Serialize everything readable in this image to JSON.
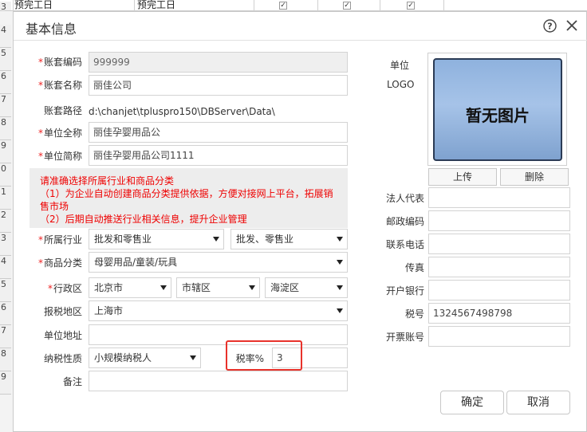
{
  "background": {
    "row_numbers": [
      "3",
      "4",
      "5",
      "6",
      "7",
      "8",
      "9",
      "0",
      "1",
      "2",
      "3",
      "4",
      "5",
      "6",
      "7",
      "8",
      "9"
    ],
    "cell1": "预完工日",
    "cell2": "预完工日"
  },
  "dialog": {
    "title": "基本信息",
    "form": {
      "account_code": {
        "label": "账套编码",
        "value": "999999"
      },
      "account_name": {
        "label": "账套名称",
        "value": "丽佳公司"
      },
      "account_path": {
        "label": "账套路径",
        "value": "d:\\chanjet\\tpluspro150\\DBServer\\Data\\"
      },
      "unit_fullname": {
        "label": "单位全称",
        "value": "丽佳孕婴用品公"
      },
      "unit_shortname": {
        "label": "单位简称",
        "value": "丽佳孕婴用品公司1111"
      },
      "notice": {
        "line1": "请准确选择所属行业和商品分类",
        "line2": "（1）为企业自动创建商品分类提供依据，方便对接网上平台，拓展销",
        "line3": "售市场",
        "line4": "（2）后期自动推送行业相关信息，提升企业管理"
      },
      "industry": {
        "label": "所属行业",
        "value1": "批发和零售业",
        "value2": "批发、零售业"
      },
      "goods_category": {
        "label": "商品分类",
        "value": "母婴用品/童装/玩具"
      },
      "region": {
        "label": "行政区",
        "province": "北京市",
        "city": "市辖区",
        "district": "海淀区"
      },
      "tax_region": {
        "label": "报税地区",
        "value": "上海市"
      },
      "unit_address": {
        "label": "单位地址",
        "value": ""
      },
      "tax_nature": {
        "label": "纳税性质",
        "value": "小规模纳税人"
      },
      "tax_rate": {
        "label": "税率%",
        "value": "3"
      },
      "remark": {
        "label": "备注",
        "value": ""
      }
    },
    "logo": {
      "label_line1": "单位",
      "label_line2": "LOGO",
      "placeholder": "暂无图片",
      "upload_label": "上传",
      "delete_label": "删除"
    },
    "right_fields": {
      "legal_rep": {
        "label": "法人代表",
        "value": ""
      },
      "postal_code": {
        "label": "邮政编码",
        "value": ""
      },
      "phone": {
        "label": "联系电话",
        "value": ""
      },
      "fax": {
        "label": "传真",
        "value": ""
      },
      "bank": {
        "label": "开户银行",
        "value": ""
      },
      "tax_no": {
        "label": "税号",
        "value": "1324567498798"
      },
      "invoice_account": {
        "label": "开票账号",
        "value": ""
      }
    },
    "buttons": {
      "ok": "确定",
      "cancel": "取消"
    },
    "colors": {
      "required": "#e22222",
      "notice_text": "#e00000",
      "highlight": "#e8322b",
      "logo_bg": "#a6c3e8"
    }
  }
}
